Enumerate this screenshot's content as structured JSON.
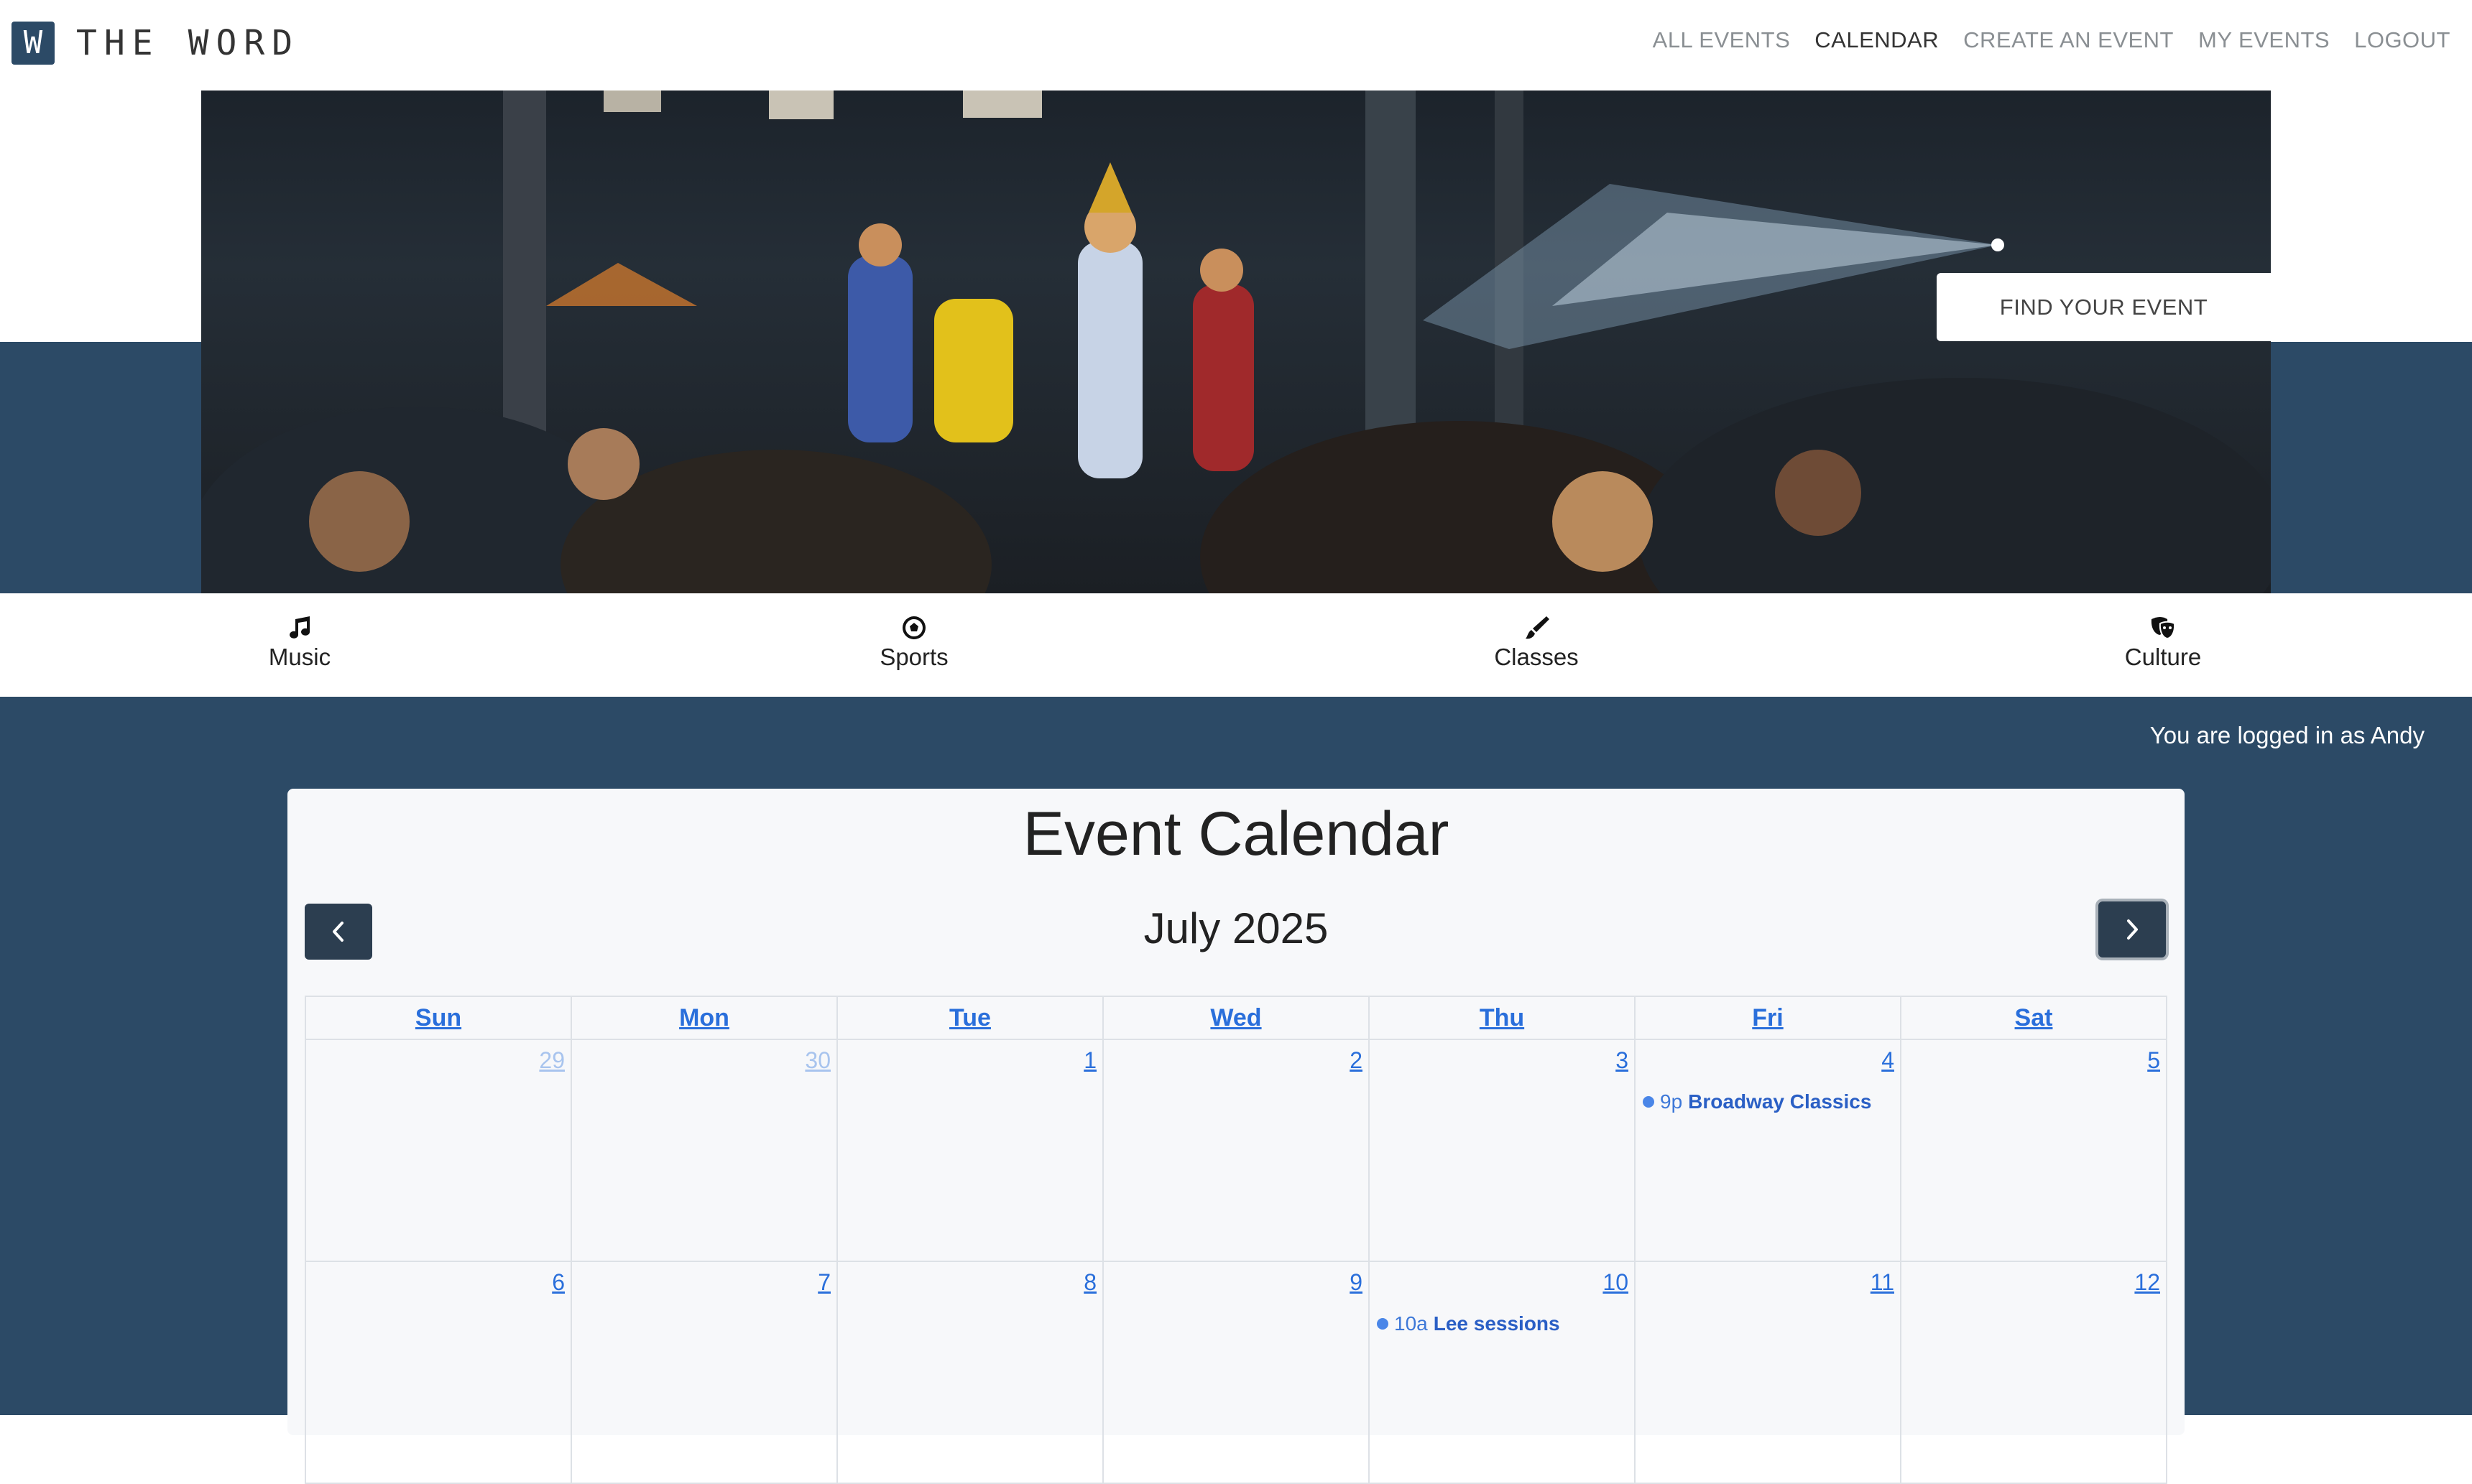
{
  "brand": {
    "logo_letter": "W",
    "name": "THE WORD"
  },
  "nav": {
    "items": [
      {
        "label": "ALL EVENTS",
        "active": false
      },
      {
        "label": "CALENDAR",
        "active": true
      },
      {
        "label": "CREATE AN EVENT",
        "active": false
      },
      {
        "label": "MY EVENTS",
        "active": false
      },
      {
        "label": "LOGOUT",
        "active": false
      }
    ]
  },
  "hero": {
    "find_button": "FIND YOUR EVENT"
  },
  "categories": [
    {
      "label": "Music",
      "icon": "music-note-icon"
    },
    {
      "label": "Sports",
      "icon": "soccer-ball-icon"
    },
    {
      "label": "Classes",
      "icon": "paintbrush-icon"
    },
    {
      "label": "Culture",
      "icon": "theater-masks-icon"
    }
  ],
  "user": {
    "logged_in_text": "You are logged in as Andy"
  },
  "calendar": {
    "title": "Event Calendar",
    "month": "July 2025",
    "weekdays": [
      "Sun",
      "Mon",
      "Tue",
      "Wed",
      "Thu",
      "Fri",
      "Sat"
    ],
    "weeks": [
      [
        {
          "day": "29",
          "other": true
        },
        {
          "day": "30",
          "other": true
        },
        {
          "day": "1"
        },
        {
          "day": "2"
        },
        {
          "day": "3"
        },
        {
          "day": "4",
          "event": {
            "time": "9p",
            "title": "Broadway Classics"
          }
        },
        {
          "day": "5"
        }
      ],
      [
        {
          "day": "6"
        },
        {
          "day": "7"
        },
        {
          "day": "8"
        },
        {
          "day": "9"
        },
        {
          "day": "10",
          "event": {
            "time": "10a",
            "title": "Lee sessions"
          }
        },
        {
          "day": "11"
        },
        {
          "day": "12"
        }
      ]
    ]
  },
  "colors": {
    "navy": "#2c4a66",
    "link_blue": "#2a6fdb",
    "card_bg": "#f7f8fa"
  }
}
